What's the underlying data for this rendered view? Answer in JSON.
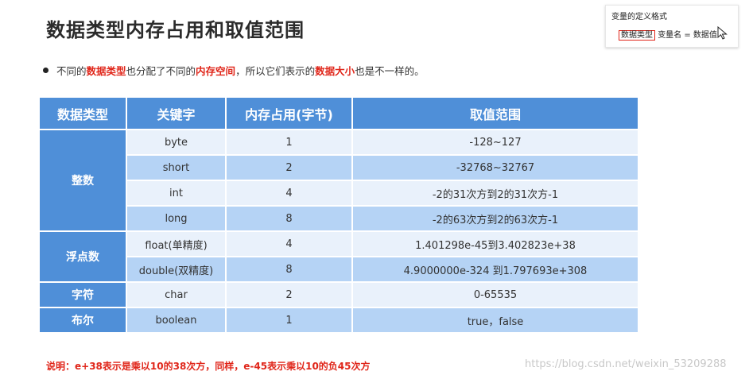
{
  "title": "数据类型内存占用和取值范围",
  "note": {
    "title": "变量的定义格式",
    "highlight": "数据类型",
    "rest": "变量名 = 数据值"
  },
  "bullet": {
    "p1": "不同的",
    "e1": "数据类型",
    "p2": "也分配了不同的",
    "e2": "内存空间",
    "p3": "，所以它们表示的",
    "e3": "数据大小",
    "p4": "也是不一样的。"
  },
  "table": {
    "headers": [
      "数据类型",
      "关键字",
      "内存占用(字节)",
      "取值范围"
    ],
    "groups": [
      {
        "category": "整数",
        "rows": [
          {
            "keyword": "byte",
            "size": "1",
            "range": "-128~127"
          },
          {
            "keyword": "short",
            "size": "2",
            "range": "-32768~32767"
          },
          {
            "keyword": "int",
            "size": "4",
            "range": "-2的31次方到2的31次方-1"
          },
          {
            "keyword": "long",
            "size": "8",
            "range": "-2的63次方到2的63次方-1"
          }
        ]
      },
      {
        "category": "浮点数",
        "rows": [
          {
            "keyword": "float(单精度)",
            "size": "4",
            "range": "1.401298e-45到3.402823e+38"
          },
          {
            "keyword": "double(双精度)",
            "size": "8",
            "range": "4.9000000e-324 到1.797693e+308"
          }
        ]
      },
      {
        "category": "字符",
        "rows": [
          {
            "keyword": "char",
            "size": "2",
            "range": "0-65535"
          }
        ]
      },
      {
        "category": "布尔",
        "rows": [
          {
            "keyword": "boolean",
            "size": "1",
            "range": "true，false"
          }
        ]
      }
    ]
  },
  "footnote": "说明：e+38表示是乘以10的38次方，同样，e-45表示乘以10的负45次方",
  "watermark": "https://blog.csdn.net/weixin_53209288"
}
